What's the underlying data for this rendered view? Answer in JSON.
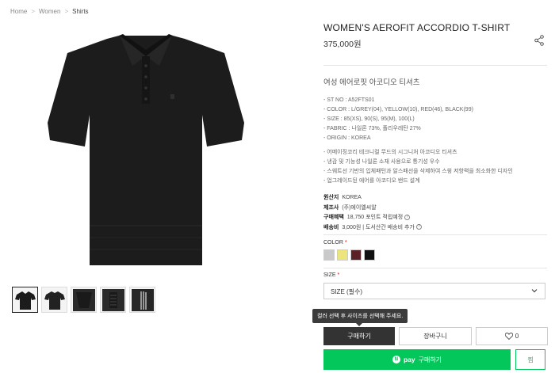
{
  "breadcrumb": {
    "home": "Home",
    "women": "Women",
    "shirts": "Shirts"
  },
  "product": {
    "title": "WOMEN'S AEROFIT ACCORDIO T-SHIRT",
    "price": "375,000원",
    "korean_name": "여성 에어로핏 아코디오 티셔츠"
  },
  "specs": [
    "- ST NO : A52FTS01",
    "- COLOR : L/GREY(04), YELLOW(10), RED(46), BLACK(99)",
    "- SIZE : 85(XS), 90(S), 95(M), 100(L)",
    "- FABRIC : 나일론 73%, 폴리우레탄 27%",
    "- ORIGIN : KOREA"
  ],
  "features": [
    "- 어메이징코리 테크니컬 무드의 시그니처 아코디오 티셔츠",
    "- 냉감 및 기능성 나일론 소재 사용으로 통기성 우수",
    "- 스웨트선 기반의 입체패턴과 알스패선을 삭제하여 스윙 저항력을 최소화한 디자인",
    "- 업그레이드된 에어를 아코디오 밴드 설계"
  ],
  "meta": {
    "origin_key": "원산지",
    "origin_val": "KOREA",
    "maker_key": "제조사",
    "maker_val": "(주)에이엘씨알",
    "benefit_key": "구매혜택",
    "benefit_val": "18,750 포인트 적립예정",
    "shipping_key": "배송비",
    "shipping_val": "3,000원 | 도서산간 배송비 추가"
  },
  "options": {
    "color_label": "COLOR",
    "size_label": "SIZE",
    "required_mark": "*",
    "size_value": "SIZE (필수)",
    "swatches": [
      {
        "name": "light-grey",
        "hex": "#c9c9c9"
      },
      {
        "name": "yellow",
        "hex": "#ece57c"
      },
      {
        "name": "red",
        "hex": "#5a2226"
      },
      {
        "name": "black",
        "hex": "#111111"
      }
    ]
  },
  "tooltip": "컬러 선택 후 사이즈를 선택해 주세요.",
  "buttons": {
    "buy": "구매하기",
    "cart": "장바구니",
    "like_count": "0",
    "npay_n": "N",
    "npay_pay": "pay",
    "npay_label": "구매하기",
    "wish": "찜"
  },
  "colors": {
    "npay_green": "#03c75a",
    "buy_dark": "#333333"
  }
}
